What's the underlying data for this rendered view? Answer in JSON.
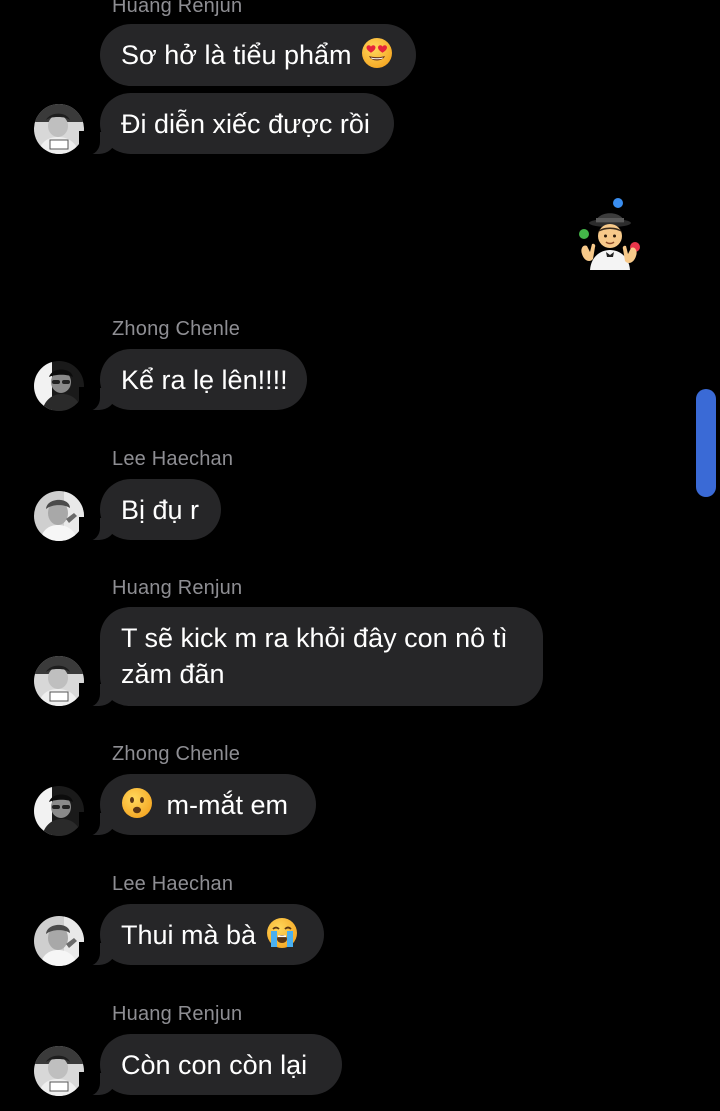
{
  "colors": {
    "background": "#000000",
    "bubble": "#262628",
    "sender_name": "#8e8e93",
    "message_text": "#ffffff",
    "scrollbar": "#3a6ad6"
  },
  "messages": [
    {
      "sender": "Huang Renjun",
      "text": "Sơ hở là tiểu phẩm",
      "emoji": "heart-eyes-emoji"
    },
    {
      "text": "Đi diễn xiếc được rồi"
    },
    {
      "sticker": "juggler-emoji"
    },
    {
      "sender": "Zhong Chenle",
      "text": "Kể ra lẹ lên!!!!"
    },
    {
      "sender": "Lee Haechan",
      "text": "Bị đụ r"
    },
    {
      "sender": "Huang Renjun",
      "text": "T sẽ kick m ra khỏi đây con nô tì zăm đãn"
    },
    {
      "sender": "Zhong Chenle",
      "text": "m-mắt em",
      "emoji": "frowning-emoji"
    },
    {
      "sender": "Lee Haechan",
      "text": "Thui mà bà",
      "emoji": "crying-emoji"
    },
    {
      "sender": "Huang Renjun",
      "text": "Còn con còn lại"
    }
  ]
}
